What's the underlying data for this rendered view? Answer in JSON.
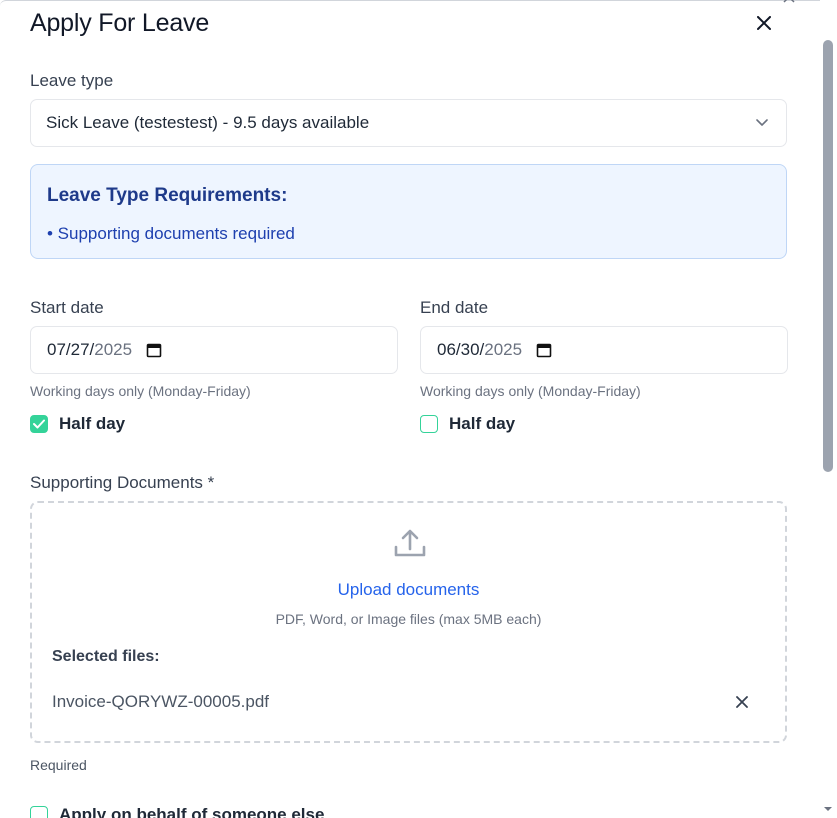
{
  "dialog": {
    "title": "Apply For Leave"
  },
  "leave_type": {
    "label": "Leave type",
    "selected": "Sick Leave (testestest) - 9.5 days available"
  },
  "requirements": {
    "title": "Leave Type Requirements:",
    "items": [
      "• Supporting documents required"
    ]
  },
  "start_date": {
    "label": "Start date",
    "value_mmdd": "07/27/",
    "value_year": "2025",
    "help": "Working days only (Monday-Friday)",
    "half_day_label": "Half day",
    "half_day_checked": true
  },
  "end_date": {
    "label": "End date",
    "value_mmdd": "06/30/",
    "value_year": "2025",
    "help": "Working days only (Monday-Friday)",
    "half_day_label": "Half day",
    "half_day_checked": false
  },
  "documents": {
    "label": "Supporting Documents *",
    "upload_link": "Upload documents",
    "hint": "PDF, Word, or Image files (max 5MB each)",
    "selected_title": "Selected files:",
    "files": [
      "Invoice-QORYWZ-00005.pdf"
    ],
    "required_text": "Required"
  },
  "behalf": {
    "label": "Apply on behalf of someone else"
  },
  "colors": {
    "accent_green": "#34d399",
    "link_blue": "#2563eb",
    "info_bg": "#eef5ff"
  }
}
